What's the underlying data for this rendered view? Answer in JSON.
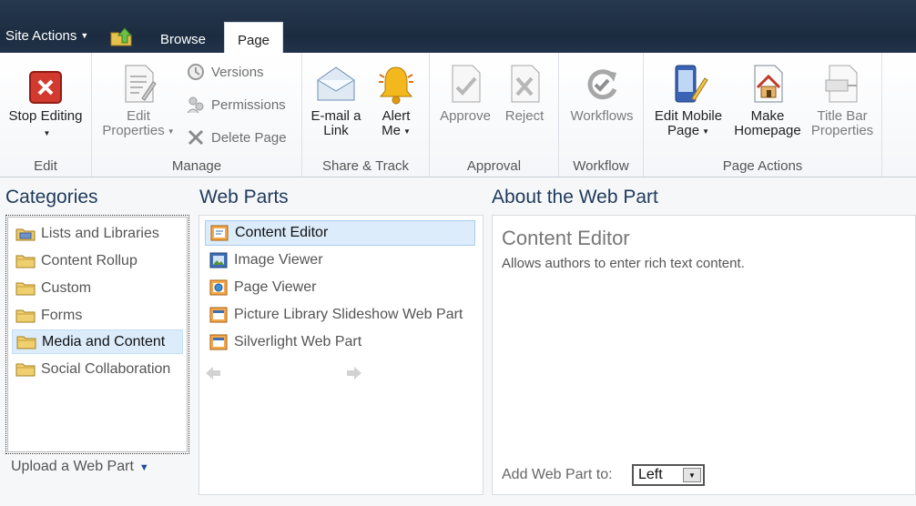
{
  "topbar": {
    "site_actions": "Site Actions",
    "tabs": [
      {
        "label": "Browse"
      },
      {
        "label": "Page"
      }
    ]
  },
  "ribbon": {
    "groups": {
      "edit": "Edit",
      "manage": "Manage",
      "share": "Share & Track",
      "approval": "Approval",
      "workflow": "Workflow",
      "page_actions": "Page Actions"
    },
    "buttons": {
      "stop_editing": "Stop Editing",
      "edit_properties_1": "Edit",
      "edit_properties_2": "Properties",
      "versions": "Versions",
      "permissions": "Permissions",
      "delete_page": "Delete Page",
      "email_1": "E-mail a",
      "email_2": "Link",
      "alert_1": "Alert",
      "alert_2": "Me",
      "approve": "Approve",
      "reject": "Reject",
      "workflows": "Workflows",
      "edit_mobile_1": "Edit Mobile",
      "edit_mobile_2": "Page",
      "make_home_1": "Make",
      "make_home_2": "Homepage",
      "title_bar_1": "Title Bar",
      "title_bar_2": "Properties"
    }
  },
  "categories": {
    "title": "Categories",
    "items": [
      {
        "label": "Lists and Libraries"
      },
      {
        "label": "Content Rollup"
      },
      {
        "label": "Custom"
      },
      {
        "label": "Forms"
      },
      {
        "label": "Media and Content"
      },
      {
        "label": "Social Collaboration"
      }
    ],
    "upload": "Upload a Web Part"
  },
  "webparts": {
    "title": "Web Parts",
    "items": [
      {
        "label": "Content Editor"
      },
      {
        "label": "Image Viewer"
      },
      {
        "label": "Page Viewer"
      },
      {
        "label": "Picture Library Slideshow Web Part"
      },
      {
        "label": "Silverlight Web Part"
      }
    ]
  },
  "about": {
    "title": "About the Web Part",
    "part_name": "Content Editor",
    "description": "Allows authors to enter rich text content.",
    "add_label": "Add Web Part to:",
    "add_value": "Left"
  },
  "colors": {
    "topbar": "#21334a",
    "selection": "#dcecfb",
    "heading": "#1f3a5c"
  }
}
